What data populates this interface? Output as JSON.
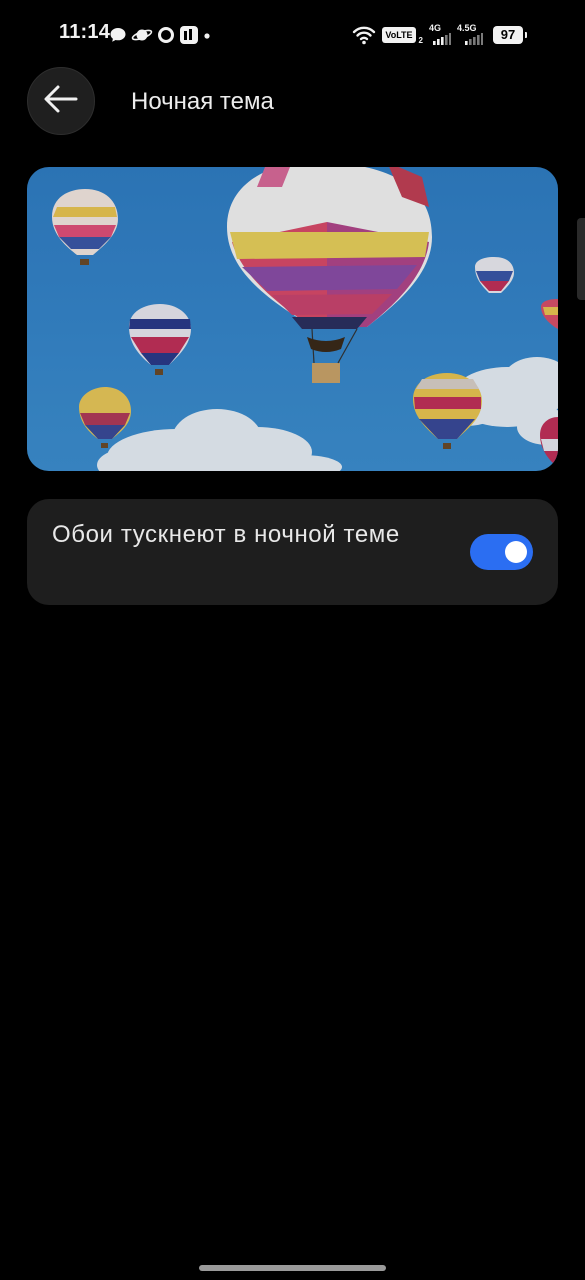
{
  "status_bar": {
    "time": "11:14",
    "left_icons": [
      "chat-bubble-icon",
      "planet-icon",
      "ring-app-icon",
      "mi-app-icon",
      "dot-icon"
    ],
    "volte": "VoLTE",
    "volte_sim": "2",
    "network_1": "4G",
    "network_2": "4.5G",
    "battery": "97",
    "icons": [
      "wifi-icon",
      "signal-icon",
      "signal-icon",
      "battery-icon"
    ]
  },
  "header": {
    "back_icon": "arrow-left-icon",
    "title": "Ночная тема"
  },
  "preview": {
    "subject": "hot-air-balloons-wallpaper"
  },
  "setting": {
    "label": "Обои тускнеют в ночной теме",
    "toggle_on": true
  },
  "colors": {
    "background": "#000000",
    "card": "#1e1e1e",
    "toggle_accent": "#2b6ef2"
  }
}
